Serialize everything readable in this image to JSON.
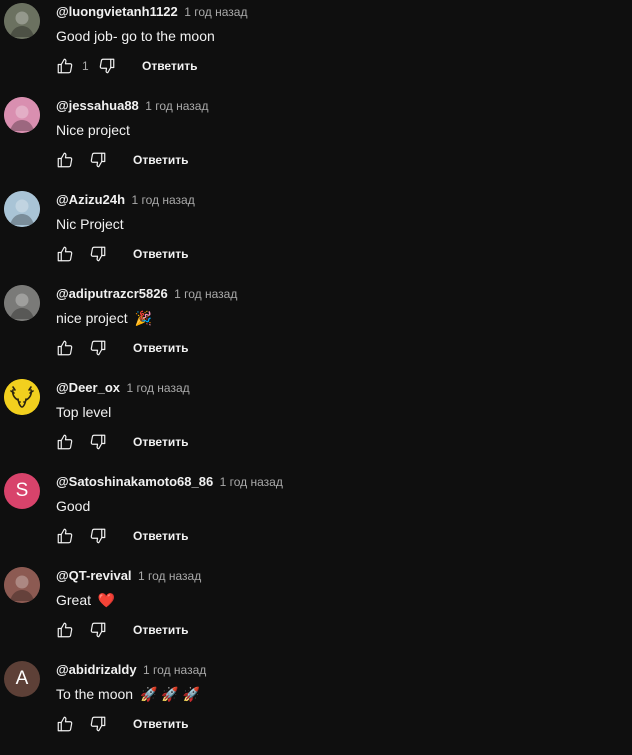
{
  "comments": [
    {
      "author": "@luongvietanh1122",
      "time": "1 год назад",
      "text": "Good job- go to the moon",
      "emoji": "",
      "likes": "1",
      "reply": "Ответить",
      "avatar": {
        "kind": "photo",
        "letter": "",
        "bg": "#6b7160"
      }
    },
    {
      "author": "@jessahua88",
      "time": "1 год назад",
      "text": "Nice project",
      "emoji": "",
      "likes": "",
      "reply": "Ответить",
      "avatar": {
        "kind": "photo",
        "letter": "",
        "bg": "#d98fb0"
      }
    },
    {
      "author": "@Azizu24h",
      "time": "1 год назад",
      "text": "Nic Project",
      "emoji": "",
      "likes": "",
      "reply": "Ответить",
      "avatar": {
        "kind": "photo",
        "letter": "",
        "bg": "#a9c4d6"
      }
    },
    {
      "author": "@adiputrazcr5826",
      "time": "1 год назад",
      "text": "nice project",
      "emoji": "🎉",
      "likes": "",
      "reply": "Ответить",
      "avatar": {
        "kind": "photo",
        "letter": "",
        "bg": "#7a7a78"
      }
    },
    {
      "author": "@Deer_ox",
      "time": "1 год назад",
      "text": "Top level",
      "emoji": "",
      "likes": "",
      "reply": "Ответить",
      "avatar": {
        "kind": "deer",
        "letter": "",
        "bg": "#f2d01e"
      }
    },
    {
      "author": "@Satoshinakamoto68_86",
      "time": "1 год назад",
      "text": "Good",
      "emoji": "",
      "likes": "",
      "reply": "Ответить",
      "avatar": {
        "kind": "letter",
        "letter": "S",
        "bg": "#d8436b"
      }
    },
    {
      "author": "@QT-revival",
      "time": "1 год назад",
      "text": "Great",
      "emoji": "❤️",
      "likes": "",
      "reply": "Ответить",
      "avatar": {
        "kind": "photo",
        "letter": "",
        "bg": "#8c5a52"
      }
    },
    {
      "author": "@abidrizaldy",
      "time": "1 год назад",
      "text": "To the moon",
      "emoji": "🚀 🚀 🚀",
      "likes": "",
      "reply": "Ответить",
      "avatar": {
        "kind": "letter",
        "letter": "A",
        "bg": "#5d4037"
      }
    }
  ],
  "icons": {
    "like": "thumbs-up-icon",
    "dislike": "thumbs-down-icon"
  },
  "colors": {
    "background": "#0f0f0f",
    "text": "#f1f1f1",
    "secondary_text": "#aaaaaa"
  }
}
